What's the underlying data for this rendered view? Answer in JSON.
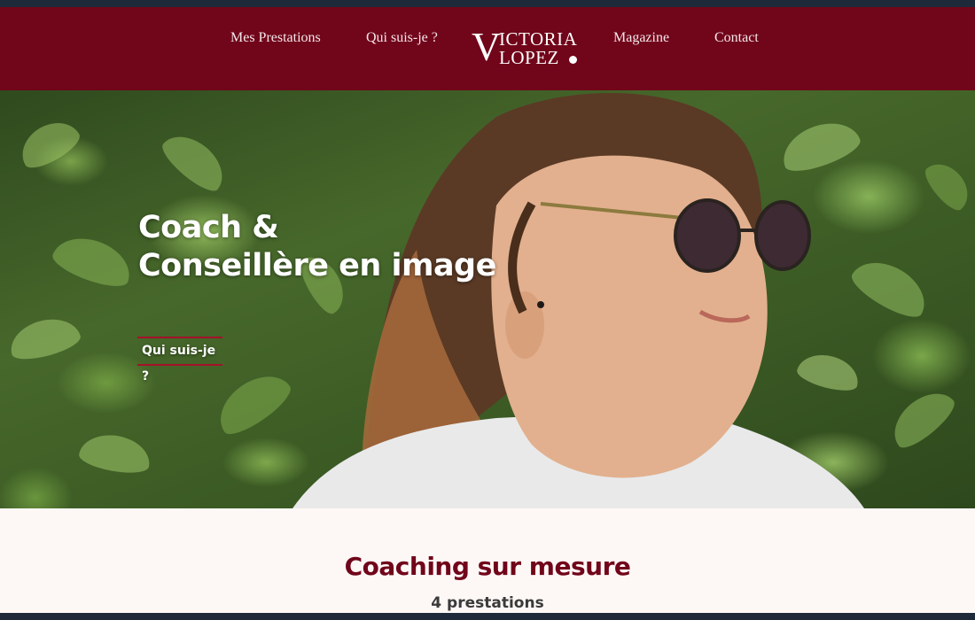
{
  "nav": {
    "items": [
      {
        "label": "Mes Prestations"
      },
      {
        "label": "Qui suis-je ?"
      },
      {
        "label": "Magazine"
      },
      {
        "label": "Contact"
      }
    ],
    "logo": {
      "initial": "V",
      "line1": "ICTORIA",
      "line2": "LOPEZ"
    }
  },
  "hero": {
    "headline_line1": "Coach &",
    "headline_line2": "Conseillère en image",
    "cta_label": "Qui suis-je ?"
  },
  "section": {
    "title": "Coaching sur mesure",
    "subtitle": "4 prestations"
  },
  "colors": {
    "brand": "#71051a",
    "accent": "#a3122a",
    "section_bg": "#fdf8f6",
    "frame": "#1e2a3a"
  }
}
